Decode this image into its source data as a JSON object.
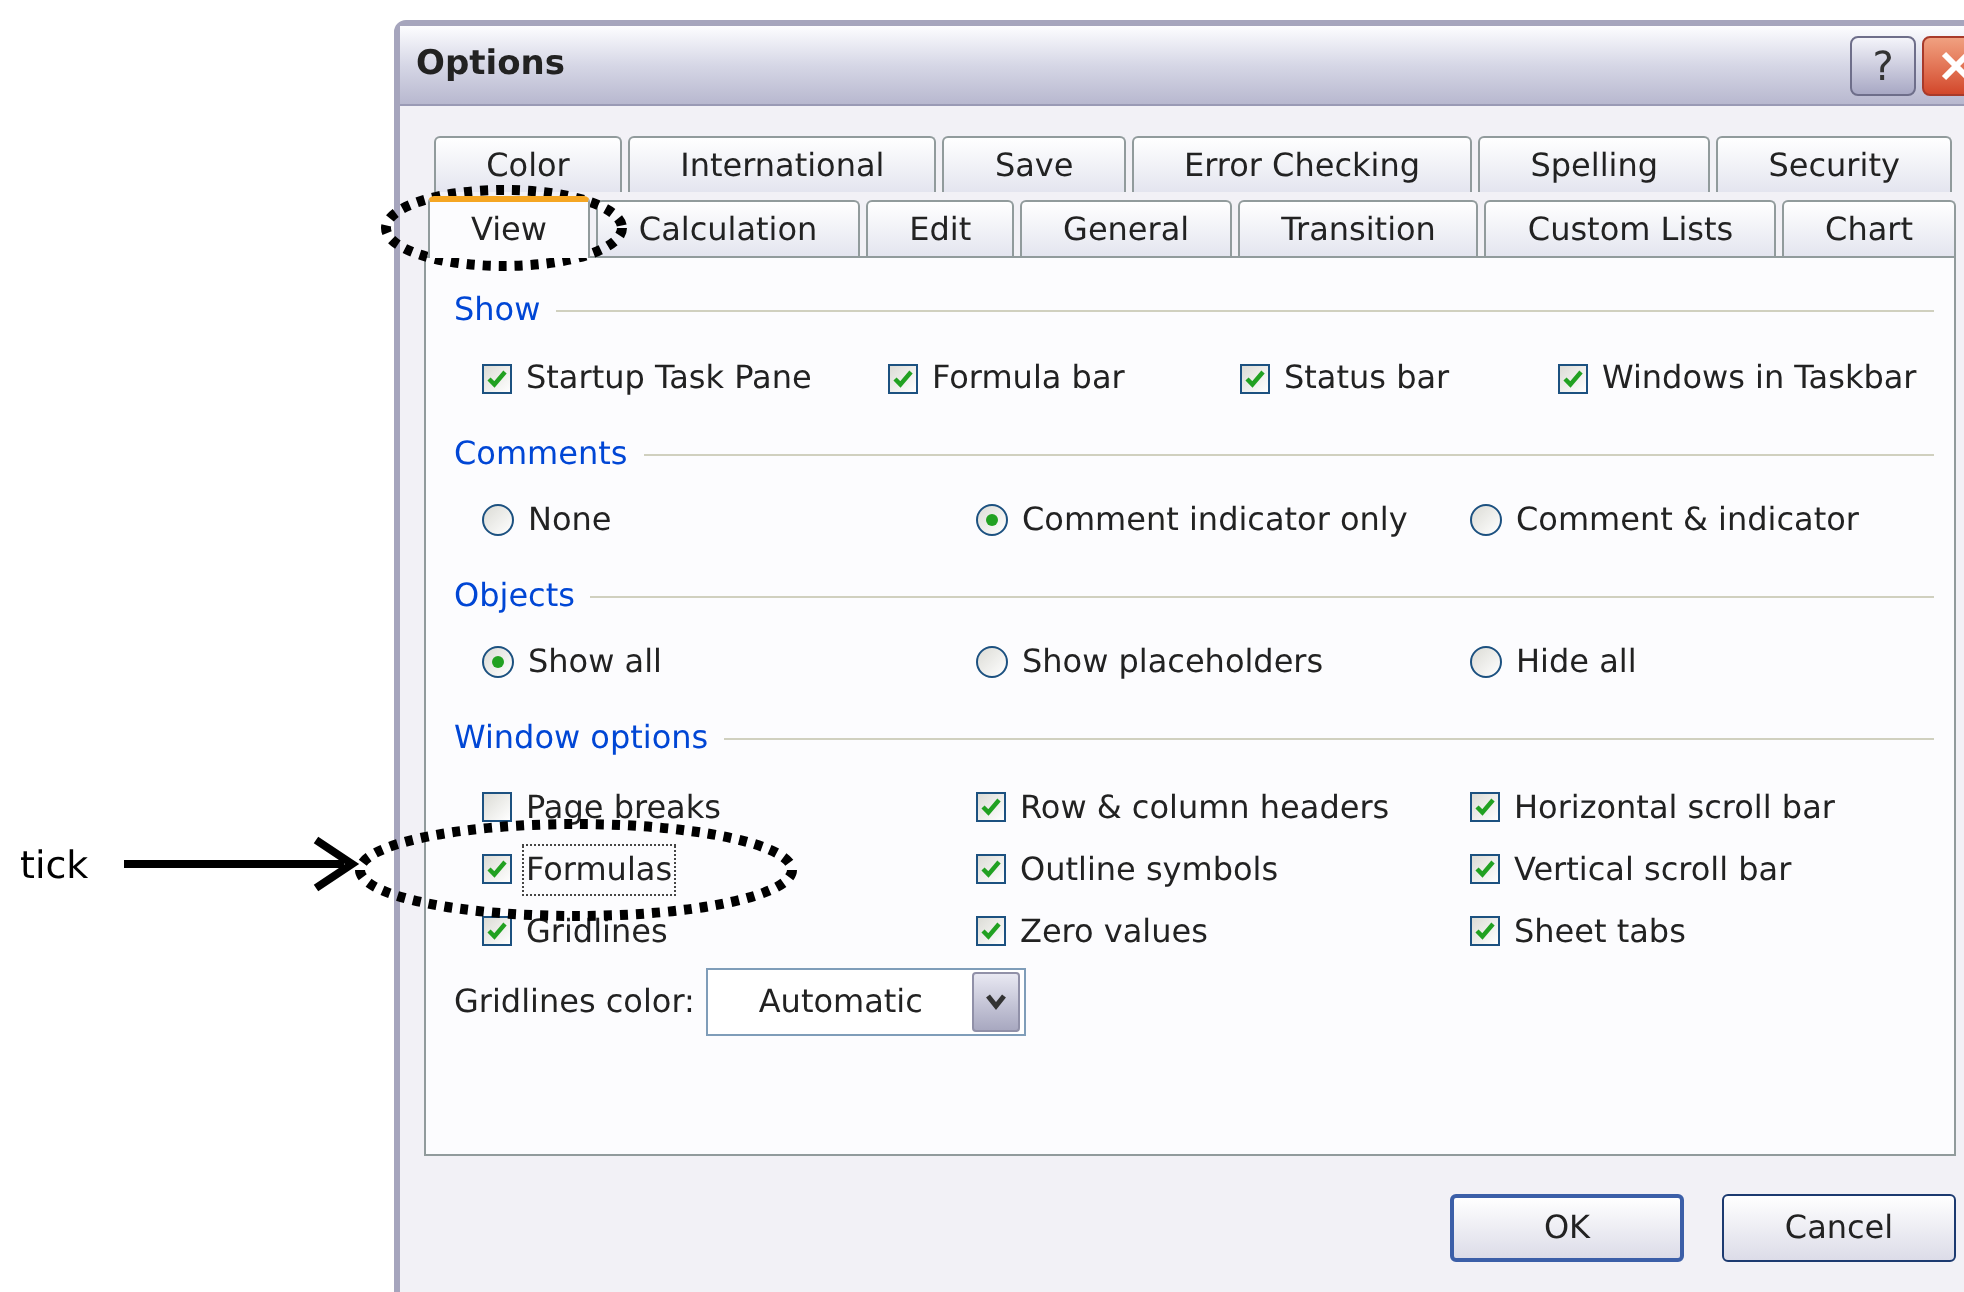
{
  "window": {
    "title": "Options",
    "help_button": "?"
  },
  "tab_rows": [
    {
      "tabs": [
        {
          "label": "Color",
          "selected": false
        },
        {
          "label": "International",
          "selected": false
        },
        {
          "label": "Save",
          "selected": false
        },
        {
          "label": "Error Checking",
          "selected": false
        },
        {
          "label": "Spelling",
          "selected": false
        },
        {
          "label": "Security",
          "selected": false
        }
      ]
    },
    {
      "tabs": [
        {
          "label": "View",
          "selected": true
        },
        {
          "label": "Calculation",
          "selected": false
        },
        {
          "label": "Edit",
          "selected": false
        },
        {
          "label": "General",
          "selected": false
        },
        {
          "label": "Transition",
          "selected": false
        },
        {
          "label": "Custom Lists",
          "selected": false
        },
        {
          "label": "Chart",
          "selected": false
        }
      ]
    }
  ],
  "sections": [
    {
      "title": "Show",
      "items": [
        {
          "kind": "checkbox",
          "label": "Startup Task Pane",
          "checked": true
        },
        {
          "kind": "checkbox",
          "label": "Formula bar",
          "checked": true
        },
        {
          "kind": "checkbox",
          "label": "Status bar",
          "checked": true
        },
        {
          "kind": "checkbox",
          "label": "Windows in Taskbar",
          "checked": true
        }
      ]
    },
    {
      "title": "Comments",
      "items": [
        {
          "kind": "radio",
          "label": "None",
          "selected": false
        },
        {
          "kind": "radio",
          "label": "Comment indicator only",
          "selected": true
        },
        {
          "kind": "radio",
          "label": "Comment & indicator",
          "selected": false
        }
      ]
    },
    {
      "title": "Objects",
      "items": [
        {
          "kind": "radio",
          "label": "Show all",
          "selected": true
        },
        {
          "kind": "radio",
          "label": "Show placeholders",
          "selected": false
        },
        {
          "kind": "radio",
          "label": "Hide all",
          "selected": false
        }
      ]
    },
    {
      "title": "Window options",
      "items": [
        {
          "kind": "checkbox",
          "label": "Page breaks",
          "checked": false
        },
        {
          "kind": "checkbox",
          "label": "Row & column headers",
          "checked": true
        },
        {
          "kind": "checkbox",
          "label": "Horizontal scroll bar",
          "checked": true
        },
        {
          "kind": "checkbox",
          "label": "Formulas",
          "checked": true,
          "focused": true
        },
        {
          "kind": "checkbox",
          "label": "Outline symbols",
          "checked": true
        },
        {
          "kind": "checkbox",
          "label": "Vertical scroll bar",
          "checked": true
        },
        {
          "kind": "checkbox",
          "label": "Gridlines",
          "checked": true
        },
        {
          "kind": "checkbox",
          "label": "Zero values",
          "checked": true
        },
        {
          "kind": "checkbox",
          "label": "Sheet tabs",
          "checked": true
        }
      ],
      "dropdown": {
        "label": "Gridlines color:",
        "value": "Automatic"
      }
    }
  ],
  "buttons": [
    {
      "label": "OK",
      "default": true
    },
    {
      "label": "Cancel",
      "default": false
    }
  ],
  "annotation": {
    "label": "tick"
  }
}
